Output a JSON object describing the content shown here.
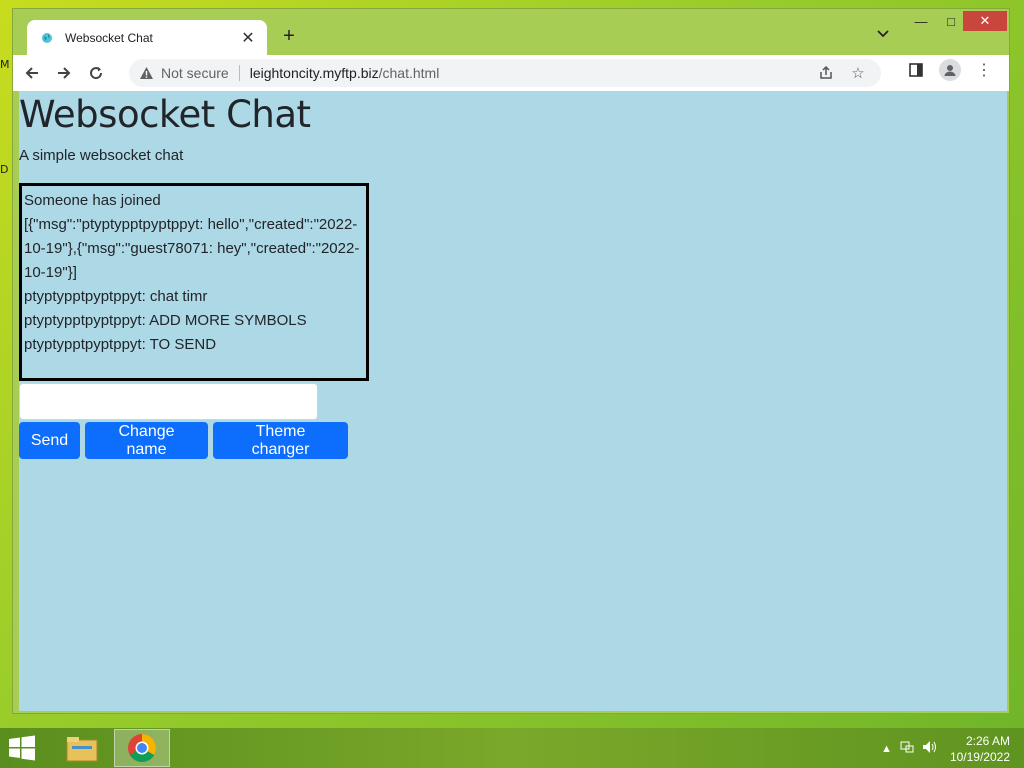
{
  "desktop": {
    "letters": [
      "M",
      "D"
    ]
  },
  "browser": {
    "tab": {
      "title": "Websocket Chat",
      "favicon": "globe-icon"
    },
    "window_controls": {
      "minimize": "—",
      "maximize": "□",
      "close": "✕"
    },
    "address_bar": {
      "security_label": "Not secure",
      "url_host": "leightoncity.myftp.biz",
      "url_path": "/chat.html"
    }
  },
  "page": {
    "title": "Websocket Chat",
    "subtitle": "A simple websocket chat",
    "chat_lines": [
      "Someone has joined",
      "[{\"msg\":\"ptyptypptpyptppyt: hello\",\"created\":\"2022-10-19\"},{\"msg\":\"guest78071: hey\",\"created\":\"2022-10-19\"}]",
      "ptyptypptpyptppyt: chat timr",
      "ptyptypptpyptppyt: ADD MORE SYMBOLS",
      "ptyptypptpyptppyt: TO SEND"
    ],
    "message_input": {
      "value": "",
      "placeholder": ""
    },
    "buttons": {
      "send": "Send",
      "change_name": "Change name",
      "theme_changer": "Theme changer"
    },
    "colors": {
      "page_bg": "#add8e6",
      "button": "#0d6efd"
    }
  },
  "taskbar": {
    "apps": [
      "file-explorer-icon",
      "chrome-icon"
    ],
    "clock": {
      "time": "2:26 AM",
      "date": "10/19/2022"
    }
  }
}
